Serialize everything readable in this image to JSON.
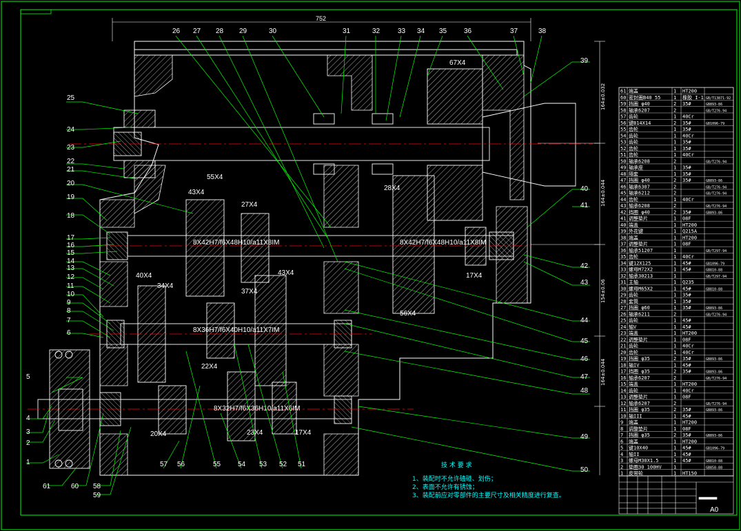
{
  "dimensions": {
    "overall_width": "752",
    "height_top": "164±0.032",
    "height_right_1": "164±0.044",
    "height_right_2": "164±0.044",
    "height_right_3": "154±0.06"
  },
  "gear_labels": [
    "67X4",
    "55X4",
    "43X4",
    "27X4",
    "28X4",
    "40X4",
    "34X4",
    "37X4",
    "43X4",
    "17X4",
    "56X4",
    "22X4",
    "20X4",
    "23X4",
    "17X4"
  ],
  "shaft_labels": [
    "8X42H7/f6X48H10/a11X8IM",
    "8X42H7/f6X48H10/a11X8IM",
    "8X36H7/f6X40H10/a11X7IM",
    "8X32H7/f6X36H10/a11X6IM"
  ],
  "callouts_left": [
    "25",
    "24",
    "23",
    "22",
    "21",
    "20",
    "19",
    "18",
    "17",
    "16",
    "15",
    "14",
    "13",
    "12",
    "11",
    "10",
    "9",
    "8",
    "7",
    "6",
    "5",
    "4",
    "3",
    "2",
    "1"
  ],
  "callouts_top": [
    "26",
    "27",
    "28",
    "29",
    "30",
    "31",
    "32",
    "33",
    "34",
    "35",
    "36",
    "37",
    "38"
  ],
  "callouts_right": [
    "39",
    "40",
    "41",
    "42",
    "43",
    "44",
    "45",
    "46",
    "47",
    "48",
    "49",
    "50"
  ],
  "callouts_bottom": [
    "61",
    "60",
    "58",
    "59",
    "57",
    "56",
    "55",
    "54",
    "53",
    "52",
    "51"
  ],
  "notes": {
    "title": "技 术 要 求",
    "items": [
      "1、装配时不允许磕碰、划伤；",
      "2、表面不允许有锈蚀；",
      "3、装配前应对零部件的主要尺寸及相关精度进行复查。"
    ]
  },
  "bom": [
    [
      "61",
      "端盖",
      "1",
      "HT200",
      ""
    ],
    [
      "60",
      "密封圈B40 55",
      "1",
      "橡胶 I-1",
      "GB/T13871-92"
    ],
    [
      "59",
      "挡圈 φ40",
      "2",
      "35#",
      "GB893-86"
    ],
    [
      "58",
      "轴承6207",
      "2",
      "",
      "GB/T276-94"
    ],
    [
      "57",
      "齿轮",
      "1",
      "40Cr",
      ""
    ],
    [
      "56",
      "键B14X14",
      "2",
      "35#",
      "GB1096-79"
    ],
    [
      "55",
      "齿轮",
      "1",
      "35#",
      ""
    ],
    [
      "54",
      "齿轮",
      "1",
      "40Cr",
      ""
    ],
    [
      "53",
      "齿轮",
      "1",
      "35#",
      ""
    ],
    [
      "52",
      "齿轮",
      "1",
      "35#",
      ""
    ],
    [
      "51",
      "齿轮",
      "1",
      "40Cr",
      ""
    ],
    [
      "50",
      "轴承6208",
      "2",
      "",
      "GB/T276-94"
    ],
    [
      "49",
      "轴承座",
      "1",
      "35#",
      ""
    ],
    [
      "48",
      "隔套",
      "1",
      "35#",
      ""
    ],
    [
      "47",
      "挡圈 φ40",
      "2",
      "35#",
      "GB893-86"
    ],
    [
      "46",
      "轴承6307",
      "2",
      "",
      "GB/T276-94"
    ],
    [
      "45",
      "轴承6212",
      "2",
      "",
      "GB/T276-94"
    ],
    [
      "44",
      "齿轮",
      "1",
      "40Cr",
      ""
    ],
    [
      "43",
      "轴承6208",
      "2",
      "",
      "GB/T276-94"
    ],
    [
      "42",
      "挡圈 φ40",
      "2",
      "35#",
      "GB893-86"
    ],
    [
      "41",
      "调整垫片",
      "1",
      "08F",
      ""
    ],
    [
      "40",
      "端盖",
      "1",
      "HT200",
      ""
    ],
    [
      "39",
      "外花键",
      "1",
      "Q215A",
      ""
    ],
    [
      "38",
      "端盖",
      "1",
      "HT200",
      ""
    ],
    [
      "37",
      "调整垫片",
      "1",
      "08F",
      ""
    ],
    [
      "36",
      "轴承51207",
      "1",
      "",
      "GB/T297-94"
    ],
    [
      "35",
      "齿轮",
      "1",
      "40Cr",
      ""
    ],
    [
      "34",
      "键12X125",
      "1",
      "45#",
      "GB1096-79"
    ],
    [
      "33",
      "螺母M72X2",
      "1",
      "45#",
      "GB810-88"
    ],
    [
      "32",
      "轴承30213",
      "1",
      "",
      "GB/T297-94"
    ],
    [
      "31",
      "主轴",
      "1",
      "Q235",
      ""
    ],
    [
      "30",
      "螺母M65X2",
      "1",
      "45#",
      "GB810-88"
    ],
    [
      "29",
      "齿轮",
      "1",
      "35#",
      ""
    ],
    [
      "28",
      "套筒",
      "1",
      "35#",
      ""
    ],
    [
      "27",
      "挡圈 φ60",
      "1",
      "35#",
      "GB893-86"
    ],
    [
      "26",
      "轴承6211",
      "2",
      "",
      "GB/T276-94"
    ],
    [
      "25",
      "齿轮",
      "1",
      "45#",
      ""
    ],
    [
      "24",
      "轴V",
      "1",
      "45#",
      ""
    ],
    [
      "23",
      "端盖",
      "1",
      "HT200",
      ""
    ],
    [
      "22",
      "调整垫片",
      "1",
      "08F",
      ""
    ],
    [
      "21",
      "齿轮",
      "1",
      "40Cr",
      ""
    ],
    [
      "20",
      "齿轮",
      "1",
      "40Cr",
      ""
    ],
    [
      "19",
      "挡圈 φ35",
      "2",
      "35#",
      "GB893-86"
    ],
    [
      "18",
      "轴IV",
      "1",
      "45#",
      ""
    ],
    [
      "17",
      "挡圈 φ35",
      "2",
      "35#",
      "GB893-86"
    ],
    [
      "16",
      "轴承6207",
      "2",
      "",
      "GB/T276-94"
    ],
    [
      "15",
      "端盖",
      "1",
      "HT200",
      ""
    ],
    [
      "14",
      "齿轮",
      "1",
      "40Cr",
      ""
    ],
    [
      "13",
      "调整垫片",
      "1",
      "08F",
      ""
    ],
    [
      "12",
      "轴承6207",
      "2",
      "",
      "GB/T276-94"
    ],
    [
      "11",
      "挡圈 φ35",
      "2",
      "35#",
      "GB893-86"
    ],
    [
      "10",
      "轴III",
      "1",
      "45#",
      ""
    ],
    [
      "9",
      "端盖",
      "1",
      "HT200",
      ""
    ],
    [
      "8",
      "调整垫片",
      "1",
      "08F",
      ""
    ],
    [
      "7",
      "挡圈 φ35",
      "2",
      "35#",
      "GB893-86"
    ],
    [
      "6",
      "端盖",
      "1",
      "HT200",
      ""
    ],
    [
      "5",
      "键10X40",
      "1",
      "45#",
      "GB1096-79"
    ],
    [
      "4",
      "轴II",
      "1",
      "45#",
      ""
    ],
    [
      "3",
      "螺母M30X1.5",
      "1",
      "45#",
      "GB810-88"
    ],
    [
      "2",
      "垫圈30 100HV",
      "1",
      "",
      "GB858-88"
    ],
    [
      "1",
      "皮带轮",
      "1",
      "HT150",
      ""
    ]
  ],
  "title_block": {
    "sheet_size": "A0"
  },
  "colors": {
    "background": "#000000",
    "frame": "#00ff00",
    "part": "#ffffff",
    "center": "#ff0000",
    "leader": "#00ff00",
    "hidden": "#ffff00",
    "notes": "#00ffff"
  }
}
